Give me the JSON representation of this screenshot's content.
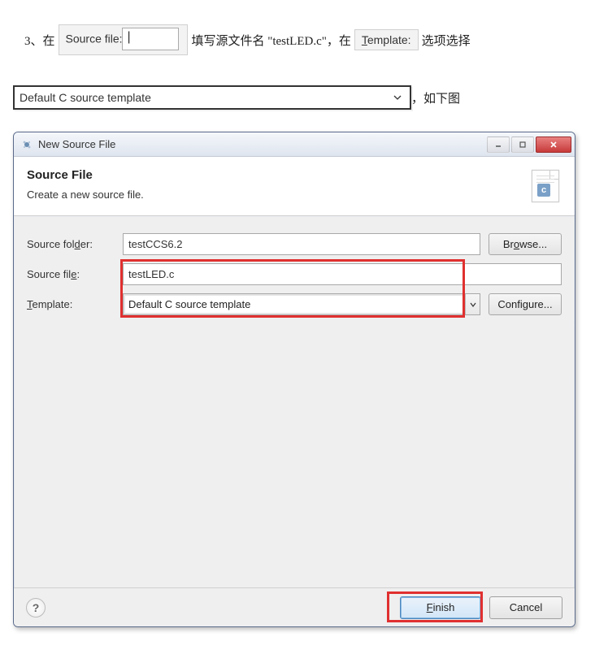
{
  "instruction": {
    "prefix": "3、在",
    "source_file_label": "Source file:",
    "after_src": " 填写源文件名 \"testLED.c\"，在 ",
    "template_label": "Template:",
    "after_tpl": " 选项选择",
    "dropdown_text": "Default C source template",
    "after_dropdown": "，如下图"
  },
  "dialog": {
    "title": "New Source File",
    "header_title": "Source File",
    "header_sub": "Create a new source file.",
    "c_letter": "c",
    "labels": {
      "source_folder": "Source folder:",
      "source_file": "Source file:",
      "template": "Template:"
    },
    "values": {
      "source_folder": "testCCS6.2",
      "source_file": "testLED.c",
      "template": "Default C source template"
    },
    "buttons": {
      "browse": "Browse...",
      "configure": "Configure...",
      "finish": "Finish",
      "cancel": "Cancel"
    },
    "help": "?"
  }
}
